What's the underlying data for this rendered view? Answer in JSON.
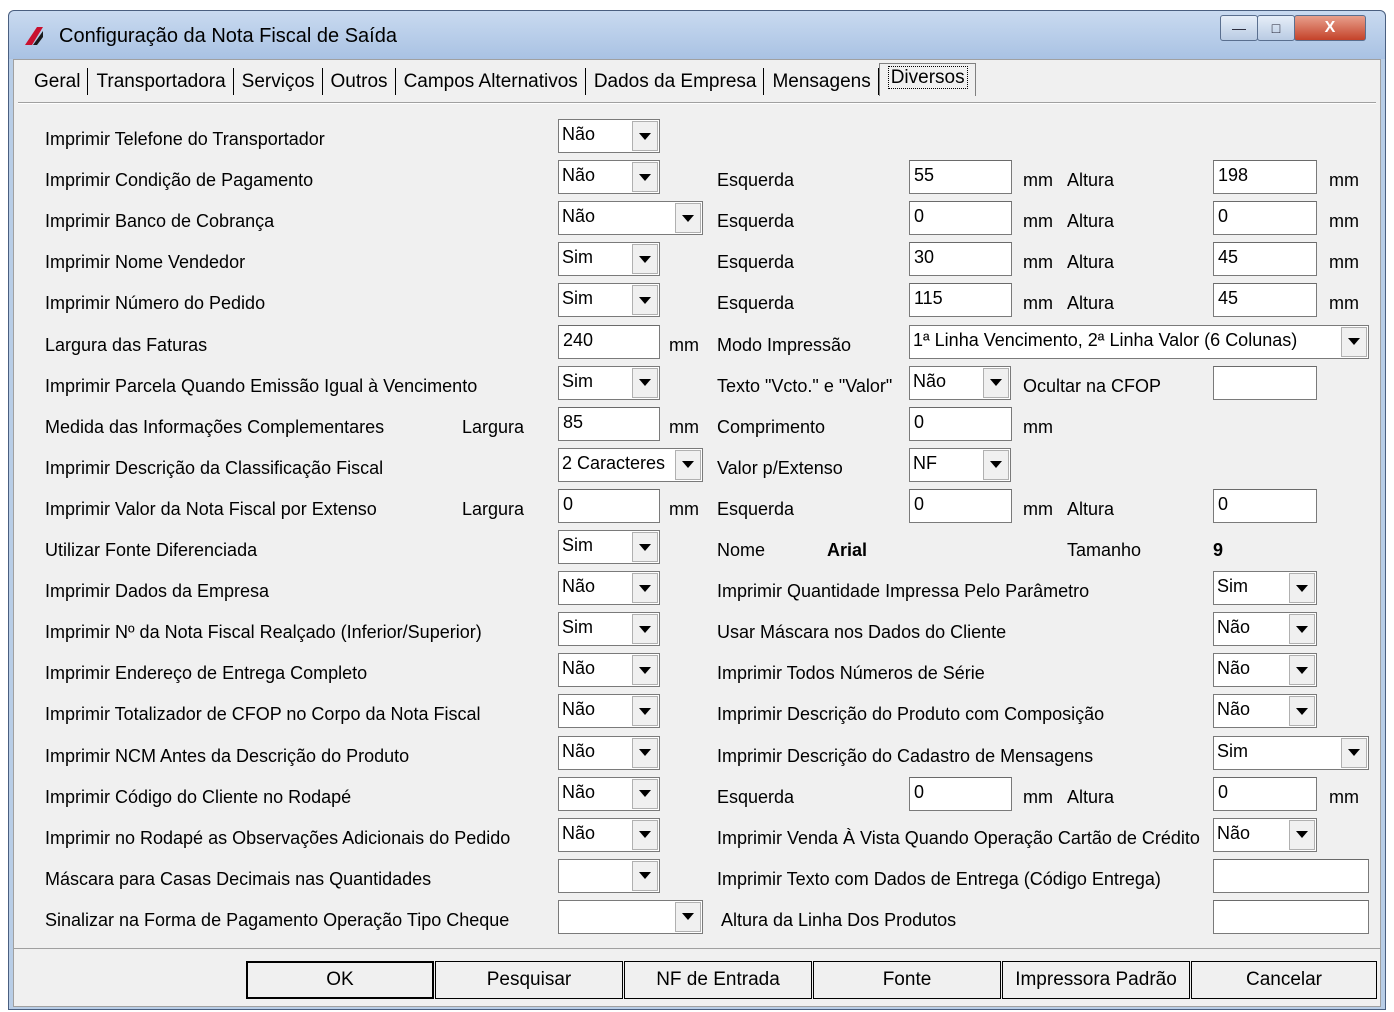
{
  "window": {
    "title": "Configuração da Nota Fiscal de Saída",
    "minimize": "—",
    "maximize": "□",
    "close": "X"
  },
  "tabs": [
    "Geral",
    "Transportadora",
    "Serviços",
    "Outros",
    "Campos Alternativos",
    "Dados da Empresa",
    "Mensagens",
    "Diversos"
  ],
  "active_tab": "Diversos",
  "left_labels": [
    "Imprimir Telefone do Transportador",
    "Imprimir Condição de Pagamento",
    "Imprimir Banco de Cobrança",
    "Imprimir Nome Vendedor",
    "Imprimir Número do Pedido",
    "Largura das Faturas",
    "Imprimir Parcela Quando Emissão Igual à Vencimento",
    "Medida das Informações Complementares",
    "Imprimir Descrição da Classificação Fiscal",
    "Imprimir Valor da Nota Fiscal por Extenso",
    "Utilizar Fonte Diferenciada",
    "Imprimir Dados da Empresa",
    "Imprimir Nº da Nota Fiscal Realçado (Inferior/Superior)",
    "Imprimir Endereço de Entrega Completo",
    "Imprimir Totalizador de CFOP no Corpo da Nota Fiscal",
    "Imprimir NCM Antes da Descrição do Produto",
    "Imprimir Código do Cliente no Rodapé",
    "Imprimir no Rodapé as Observações Adicionais do Pedido",
    "Máscara para Casas Decimais nas Quantidades",
    "Sinalizar na Forma de Pagamento Operação Tipo Cheque"
  ],
  "left_values": [
    "Não",
    "Não",
    "Não",
    "Sim",
    "Sim",
    "240",
    "Sim",
    "85",
    "2 Caracteres",
    "0",
    "Sim",
    "Não",
    "Sim",
    "Não",
    "Não",
    "Não",
    "Não",
    "Não",
    "",
    ""
  ],
  "largura_label": "Largura",
  "units": {
    "mm": "mm"
  },
  "right": {
    "esquerda": "Esquerda",
    "altura": "Altura",
    "modo_impressao": "Modo Impressão",
    "modo_value": "1ª Linha Vencimento, 2ª Linha Valor (6 Colunas)",
    "texto_vcto": "Texto \"Vcto.\" e \"Valor\"",
    "texto_vcto_value": "Não",
    "ocultar_cfop": "Ocultar na CFOP",
    "ocultar_cfop_value": "",
    "comprimento": "Comprimento",
    "comprimento_value": "0",
    "valor_extenso": "Valor p/Extenso",
    "valor_extenso_value": "NF",
    "nome": "Nome",
    "nome_value": "Arial",
    "tamanho": "Tamanho",
    "tamanho_value": "9",
    "row_condicao": {
      "esq": "55",
      "alt": "198"
    },
    "row_banco": {
      "esq": "0",
      "alt": "0"
    },
    "row_vendedor": {
      "esq": "30",
      "alt": "45"
    },
    "row_pedido": {
      "esq": "115",
      "alt": "45"
    },
    "row_extenso": {
      "esq": "0",
      "alt": "0"
    },
    "row_rodape": {
      "esq": "0",
      "alt": "0"
    },
    "qtd_parametro": "Imprimir Quantidade Impressa Pelo Parâmetro",
    "qtd_parametro_value": "Sim",
    "mascara_cliente": "Usar Máscara nos Dados do Cliente",
    "mascara_cliente_value": "Não",
    "numeros_serie": "Imprimir Todos Números de Série",
    "numeros_serie_value": "Não",
    "desc_composicao": "Imprimir Descrição do Produto com Composição",
    "desc_composicao_value": "Não",
    "desc_mensagens": "Imprimir Descrição do Cadastro de Mensagens",
    "desc_mensagens_value": "Sim",
    "venda_vista": "Imprimir Venda À Vista Quando Operação Cartão de Crédito",
    "venda_vista_value": "Não",
    "texto_entrega": "Imprimir Texto com Dados de Entrega (Código Entrega)",
    "texto_entrega_value": "",
    "altura_linha": "Altura da Linha Dos Produtos",
    "altura_linha_value": ""
  },
  "buttons": [
    "OK",
    "Pesquisar",
    "NF de Entrada",
    "Fonte",
    "Impressora Padrão",
    "Cancelar"
  ]
}
